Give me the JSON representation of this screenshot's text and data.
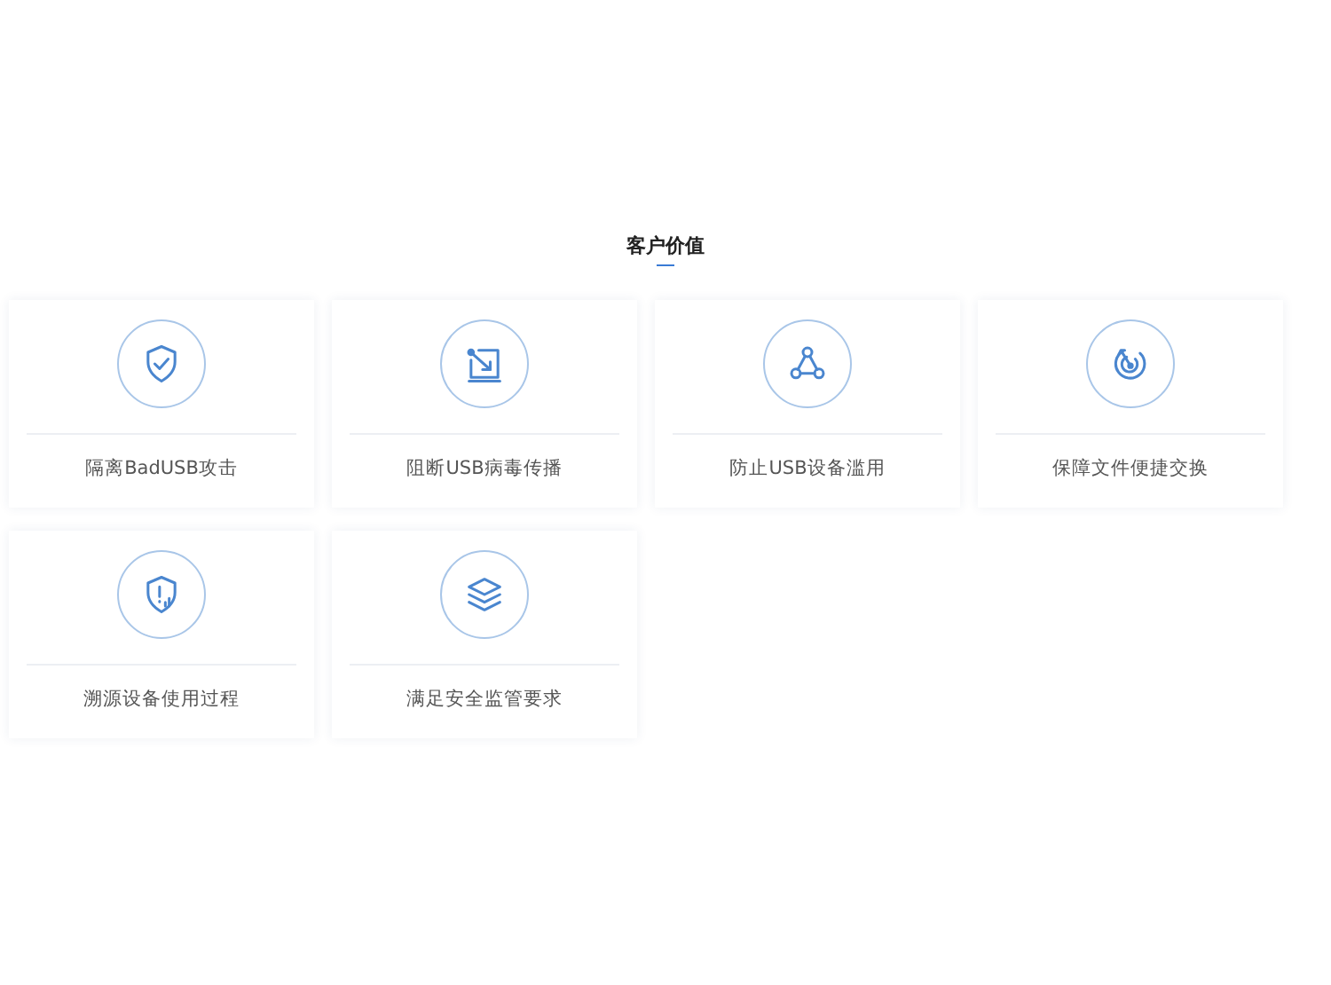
{
  "section": {
    "title": "客户价值"
  },
  "cards": [
    {
      "label": "隔离BadUSB攻击"
    },
    {
      "label": "阻断USB病毒传播"
    },
    {
      "label": "防止USB设备滥用"
    },
    {
      "label": "保障文件便捷交换"
    },
    {
      "label": "溯源设备使用过程"
    },
    {
      "label": "满足安全监管要求"
    }
  ]
}
